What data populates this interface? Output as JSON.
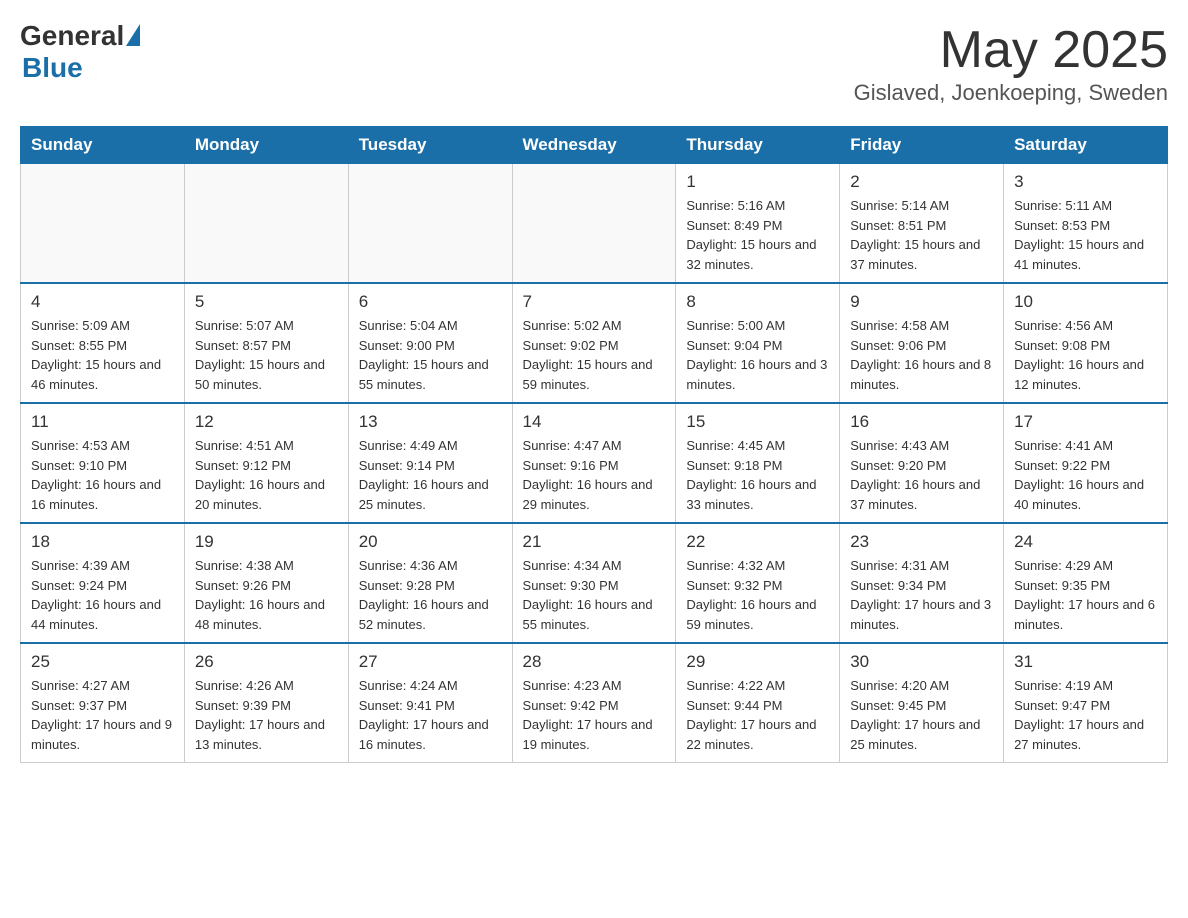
{
  "header": {
    "logo_general": "General",
    "logo_blue": "Blue",
    "month_title": "May 2025",
    "location": "Gislaved, Joenkoeping, Sweden"
  },
  "days_of_week": [
    "Sunday",
    "Monday",
    "Tuesday",
    "Wednesday",
    "Thursday",
    "Friday",
    "Saturday"
  ],
  "weeks": [
    [
      {
        "day": "",
        "info": ""
      },
      {
        "day": "",
        "info": ""
      },
      {
        "day": "",
        "info": ""
      },
      {
        "day": "",
        "info": ""
      },
      {
        "day": "1",
        "info": "Sunrise: 5:16 AM\nSunset: 8:49 PM\nDaylight: 15 hours and 32 minutes."
      },
      {
        "day": "2",
        "info": "Sunrise: 5:14 AM\nSunset: 8:51 PM\nDaylight: 15 hours and 37 minutes."
      },
      {
        "day": "3",
        "info": "Sunrise: 5:11 AM\nSunset: 8:53 PM\nDaylight: 15 hours and 41 minutes."
      }
    ],
    [
      {
        "day": "4",
        "info": "Sunrise: 5:09 AM\nSunset: 8:55 PM\nDaylight: 15 hours and 46 minutes."
      },
      {
        "day": "5",
        "info": "Sunrise: 5:07 AM\nSunset: 8:57 PM\nDaylight: 15 hours and 50 minutes."
      },
      {
        "day": "6",
        "info": "Sunrise: 5:04 AM\nSunset: 9:00 PM\nDaylight: 15 hours and 55 minutes."
      },
      {
        "day": "7",
        "info": "Sunrise: 5:02 AM\nSunset: 9:02 PM\nDaylight: 15 hours and 59 minutes."
      },
      {
        "day": "8",
        "info": "Sunrise: 5:00 AM\nSunset: 9:04 PM\nDaylight: 16 hours and 3 minutes."
      },
      {
        "day": "9",
        "info": "Sunrise: 4:58 AM\nSunset: 9:06 PM\nDaylight: 16 hours and 8 minutes."
      },
      {
        "day": "10",
        "info": "Sunrise: 4:56 AM\nSunset: 9:08 PM\nDaylight: 16 hours and 12 minutes."
      }
    ],
    [
      {
        "day": "11",
        "info": "Sunrise: 4:53 AM\nSunset: 9:10 PM\nDaylight: 16 hours and 16 minutes."
      },
      {
        "day": "12",
        "info": "Sunrise: 4:51 AM\nSunset: 9:12 PM\nDaylight: 16 hours and 20 minutes."
      },
      {
        "day": "13",
        "info": "Sunrise: 4:49 AM\nSunset: 9:14 PM\nDaylight: 16 hours and 25 minutes."
      },
      {
        "day": "14",
        "info": "Sunrise: 4:47 AM\nSunset: 9:16 PM\nDaylight: 16 hours and 29 minutes."
      },
      {
        "day": "15",
        "info": "Sunrise: 4:45 AM\nSunset: 9:18 PM\nDaylight: 16 hours and 33 minutes."
      },
      {
        "day": "16",
        "info": "Sunrise: 4:43 AM\nSunset: 9:20 PM\nDaylight: 16 hours and 37 minutes."
      },
      {
        "day": "17",
        "info": "Sunrise: 4:41 AM\nSunset: 9:22 PM\nDaylight: 16 hours and 40 minutes."
      }
    ],
    [
      {
        "day": "18",
        "info": "Sunrise: 4:39 AM\nSunset: 9:24 PM\nDaylight: 16 hours and 44 minutes."
      },
      {
        "day": "19",
        "info": "Sunrise: 4:38 AM\nSunset: 9:26 PM\nDaylight: 16 hours and 48 minutes."
      },
      {
        "day": "20",
        "info": "Sunrise: 4:36 AM\nSunset: 9:28 PM\nDaylight: 16 hours and 52 minutes."
      },
      {
        "day": "21",
        "info": "Sunrise: 4:34 AM\nSunset: 9:30 PM\nDaylight: 16 hours and 55 minutes."
      },
      {
        "day": "22",
        "info": "Sunrise: 4:32 AM\nSunset: 9:32 PM\nDaylight: 16 hours and 59 minutes."
      },
      {
        "day": "23",
        "info": "Sunrise: 4:31 AM\nSunset: 9:34 PM\nDaylight: 17 hours and 3 minutes."
      },
      {
        "day": "24",
        "info": "Sunrise: 4:29 AM\nSunset: 9:35 PM\nDaylight: 17 hours and 6 minutes."
      }
    ],
    [
      {
        "day": "25",
        "info": "Sunrise: 4:27 AM\nSunset: 9:37 PM\nDaylight: 17 hours and 9 minutes."
      },
      {
        "day": "26",
        "info": "Sunrise: 4:26 AM\nSunset: 9:39 PM\nDaylight: 17 hours and 13 minutes."
      },
      {
        "day": "27",
        "info": "Sunrise: 4:24 AM\nSunset: 9:41 PM\nDaylight: 17 hours and 16 minutes."
      },
      {
        "day": "28",
        "info": "Sunrise: 4:23 AM\nSunset: 9:42 PM\nDaylight: 17 hours and 19 minutes."
      },
      {
        "day": "29",
        "info": "Sunrise: 4:22 AM\nSunset: 9:44 PM\nDaylight: 17 hours and 22 minutes."
      },
      {
        "day": "30",
        "info": "Sunrise: 4:20 AM\nSunset: 9:45 PM\nDaylight: 17 hours and 25 minutes."
      },
      {
        "day": "31",
        "info": "Sunrise: 4:19 AM\nSunset: 9:47 PM\nDaylight: 17 hours and 27 minutes."
      }
    ]
  ]
}
